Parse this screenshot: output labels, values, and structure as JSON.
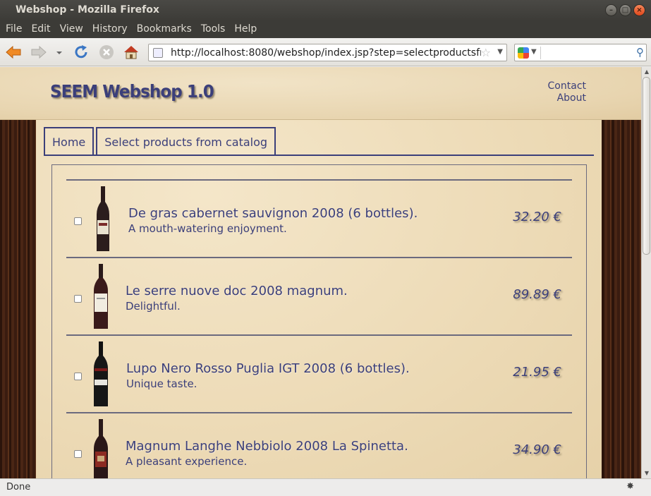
{
  "window": {
    "title": "Webshop - Mozilla Firefox",
    "minimize": "–",
    "maximize": "□",
    "close": "×"
  },
  "menu": [
    "File",
    "Edit",
    "View",
    "History",
    "Bookmarks",
    "Tools",
    "Help"
  ],
  "toolbar": {
    "url": "http://localhost:8080/webshop/index.jsp?step=selectproductsfrc",
    "icons": [
      "back-icon",
      "forward-icon",
      "history-dropdown-icon",
      "reload-icon",
      "stop-icon",
      "home-icon",
      "bookmark-star-icon",
      "google-search-engine-icon",
      "search-magnifier-icon"
    ]
  },
  "site": {
    "logo": "SEEM Webshop 1.0",
    "links": [
      "Contact",
      "About"
    ],
    "tabs": [
      "Home",
      "Select products from catalog"
    ],
    "accent": "#3b3f7a"
  },
  "products": [
    {
      "name": "De gras cabernet sauvignon 2008 (6 bottles).",
      "desc": "A mouth-watering enjoyment.",
      "price": "32.20 €",
      "checked": false
    },
    {
      "name": "Le serre nuove doc 2008 magnum.",
      "desc": "Delightful.",
      "price": "89.89 €",
      "checked": false
    },
    {
      "name": "Lupo Nero Rosso Puglia IGT 2008 (6 bottles).",
      "desc": "Unique taste.",
      "price": "21.95 €",
      "checked": false
    },
    {
      "name": "Magnum Langhe Nebbiolo 2008 La Spinetta.",
      "desc": "A pleasant experience.",
      "price": "34.90 €",
      "checked": false
    }
  ],
  "status": {
    "text": "Done"
  }
}
